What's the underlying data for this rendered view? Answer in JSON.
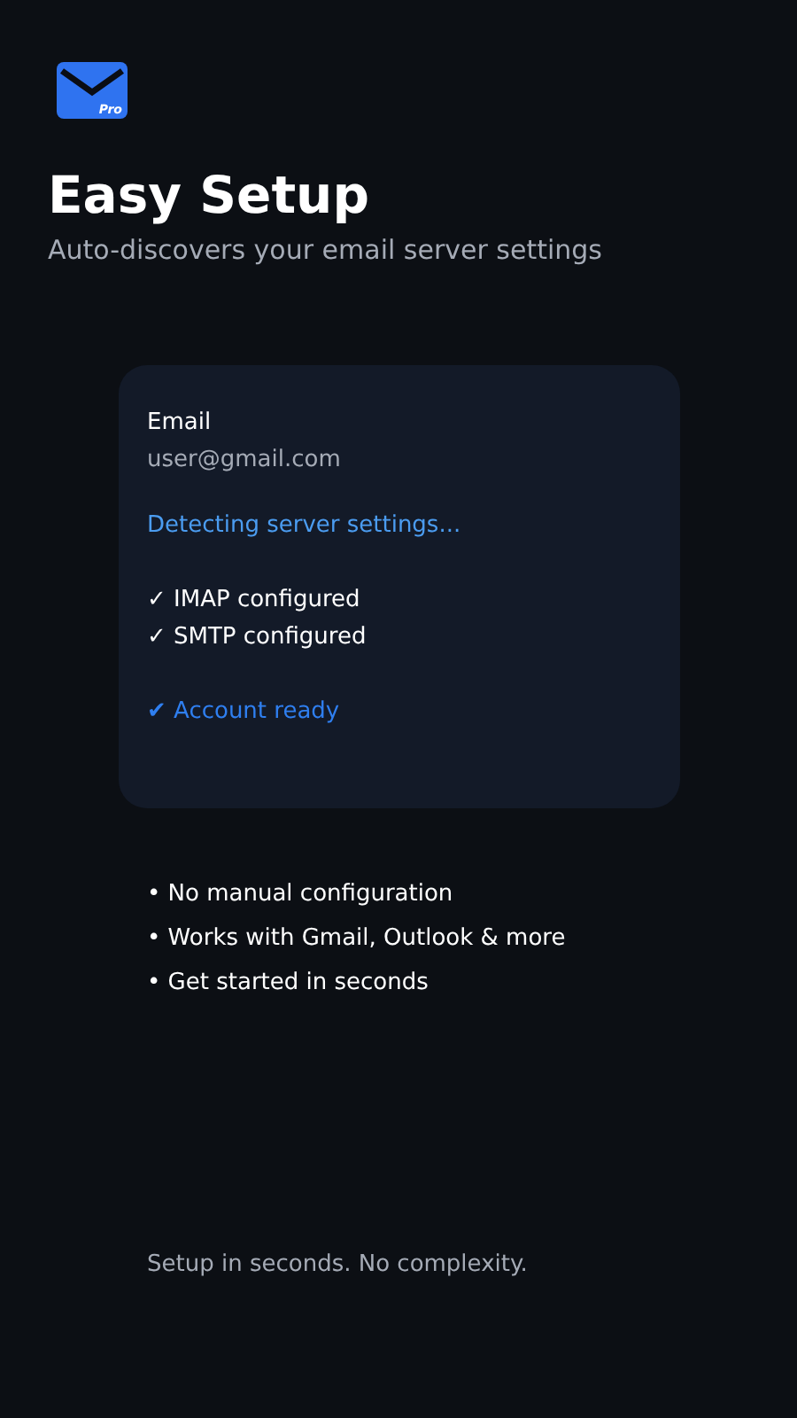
{
  "app_icon": {
    "badge": "Pro"
  },
  "header": {
    "title": "Easy Setup",
    "subtitle": "Auto-discovers your email server settings"
  },
  "card": {
    "lines": [
      {
        "kind": "label",
        "text": "Email"
      },
      {
        "kind": "value",
        "text": "user@gmail.com"
      },
      {
        "kind": "status",
        "text": "Detecting server settings..."
      },
      {
        "kind": "step",
        "text": "✓ IMAP configured"
      },
      {
        "kind": "step",
        "text": "✓ SMTP configured"
      },
      {
        "kind": "done",
        "text": "✔ Account ready"
      }
    ]
  },
  "features": [
    "• No manual configuration",
    "• Works with Gmail, Outlook & more",
    "• Get started in seconds"
  ],
  "footer": "Setup in seconds. No complexity."
}
